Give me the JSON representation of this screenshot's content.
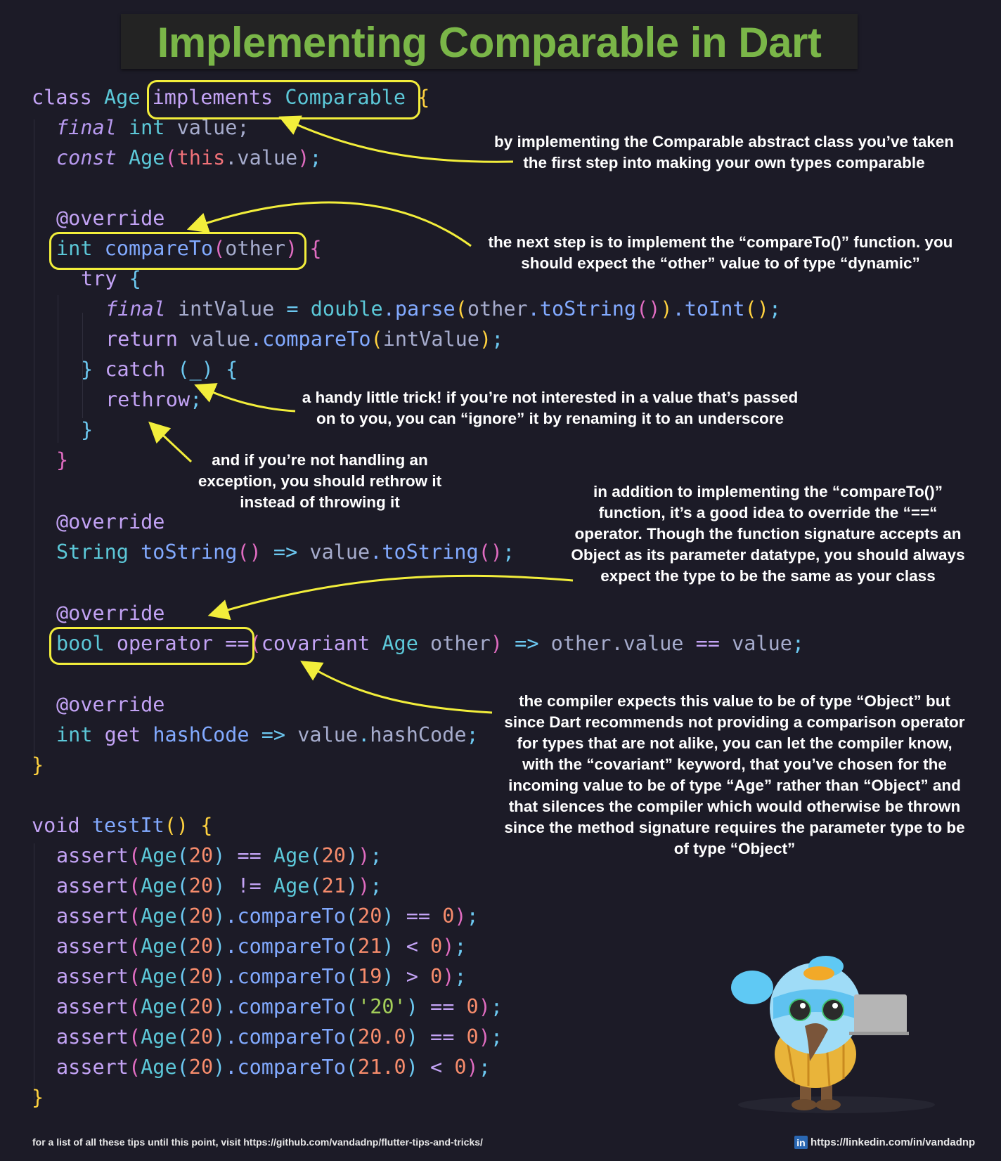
{
  "header": {
    "title": "Implementing Comparable in Dart"
  },
  "code": {
    "class_kw": "class",
    "class_name": "Age",
    "implements_kw": "implements",
    "comparable": "Comparable",
    "open_brace": "{",
    "final_kw": "final",
    "int_kw": "int",
    "value_field": "value;",
    "const_kw": "const",
    "ctor_name": "Age",
    "this_kw": "this",
    "ctor_param": ".value",
    "ctor_end": ");",
    "override": "@override",
    "compare_sig_int": "int",
    "compare_sig_name": "compareTo",
    "compare_sig_param": "other",
    "compare_open": "{",
    "try_kw": "try",
    "try_brace": "{",
    "int_value_line": {
      "final": "final",
      "name": "intValue",
      "eq": "=",
      "double": "double",
      "parse": ".parse",
      "other": "other",
      "tostring": ".toString",
      "toint": ".toInt",
      "end": ";"
    },
    "return_line": {
      "return": "return",
      "value": "value",
      "compareTo": ".compareTo",
      "arg": "intValue",
      "end": ";"
    },
    "catch_line": {
      "close": "}",
      "catch": "catch",
      "param": "(_)",
      "open": "{"
    },
    "rethrow": "rethrow",
    "semicolon": ";",
    "close_brace": "}",
    "tostring_line": {
      "type": "String",
      "name": "toString",
      "arrow": "=>",
      "value": "value",
      "call": ".toString"
    },
    "operator_line": {
      "bool": "bool",
      "operator": "operator",
      "eqeq": "==",
      "covariant": "covariant",
      "type": "Age",
      "param": "other",
      "arrow": "=>",
      "rhs_obj": "other",
      "rhs_field": ".value",
      "rhs_op": "==",
      "rhs_val": "value"
    },
    "hash_line": {
      "int": "int",
      "get": "get",
      "name": "hashCode",
      "arrow": "=>",
      "value": "value",
      "field": ".hashCode"
    },
    "void_kw": "void",
    "test_name": "testIt",
    "asserts": [
      {
        "a": "20",
        "method": "==",
        "b": "20",
        "kind": "eq"
      },
      {
        "a": "20",
        "method": "!=",
        "b": "21",
        "kind": "eq"
      },
      {
        "a": "20",
        "arg": "20",
        "op": "==",
        "rhs": "0",
        "kind": "cmp"
      },
      {
        "a": "20",
        "arg": "21",
        "op": "<",
        "rhs": "0",
        "kind": "cmp"
      },
      {
        "a": "20",
        "arg": "19",
        "op": ">",
        "rhs": "0",
        "kind": "cmp"
      },
      {
        "a": "20",
        "arg": "'20'",
        "op": "==",
        "rhs": "0",
        "kind": "cmpstr"
      },
      {
        "a": "20",
        "arg": "20.0",
        "op": "==",
        "rhs": "0",
        "kind": "cmp"
      },
      {
        "a": "20",
        "arg": "21.0",
        "op": "<",
        "rhs": "0",
        "kind": "cmp"
      }
    ]
  },
  "notes": {
    "n1": "by implementing the Comparable abstract class you’ve taken the first step into making your own types comparable",
    "n2": "the next step is to implement the “compareTo()” function. you should expect the “other” value to of type “dynamic”",
    "n3": "a handy little trick! if you’re not interested in a value that’s passed on to you, you can “ignore” it by renaming it to an underscore",
    "n4": "and if you’re not handling an exception, you should rethrow it instead of throwing it",
    "n5": "in addition to implementing the “compareTo()” function, it’s a good idea to override the “==“ operator. Though the function signature accepts an Object as its parameter datatype, you should always expect the type to be the same as your class",
    "n6": "the compiler expects this value to be of type “Object” but since Dart recommends not providing a comparison operator for types that are not alike, you can let the compiler know, with the “covariant” keyword, that you’ve chosen for the incoming value to be of type “Age” rather than “Object” and that silences the compiler which would otherwise be thrown since the method signature requires the parameter type to be of type “Object”"
  },
  "footer": {
    "left": "for a list of all these tips until this point, visit https://github.com/vandadnp/flutter-tips-and-tricks/",
    "right": "https://linkedin.com/in/vandadnp",
    "linkedin_icon": "in"
  }
}
